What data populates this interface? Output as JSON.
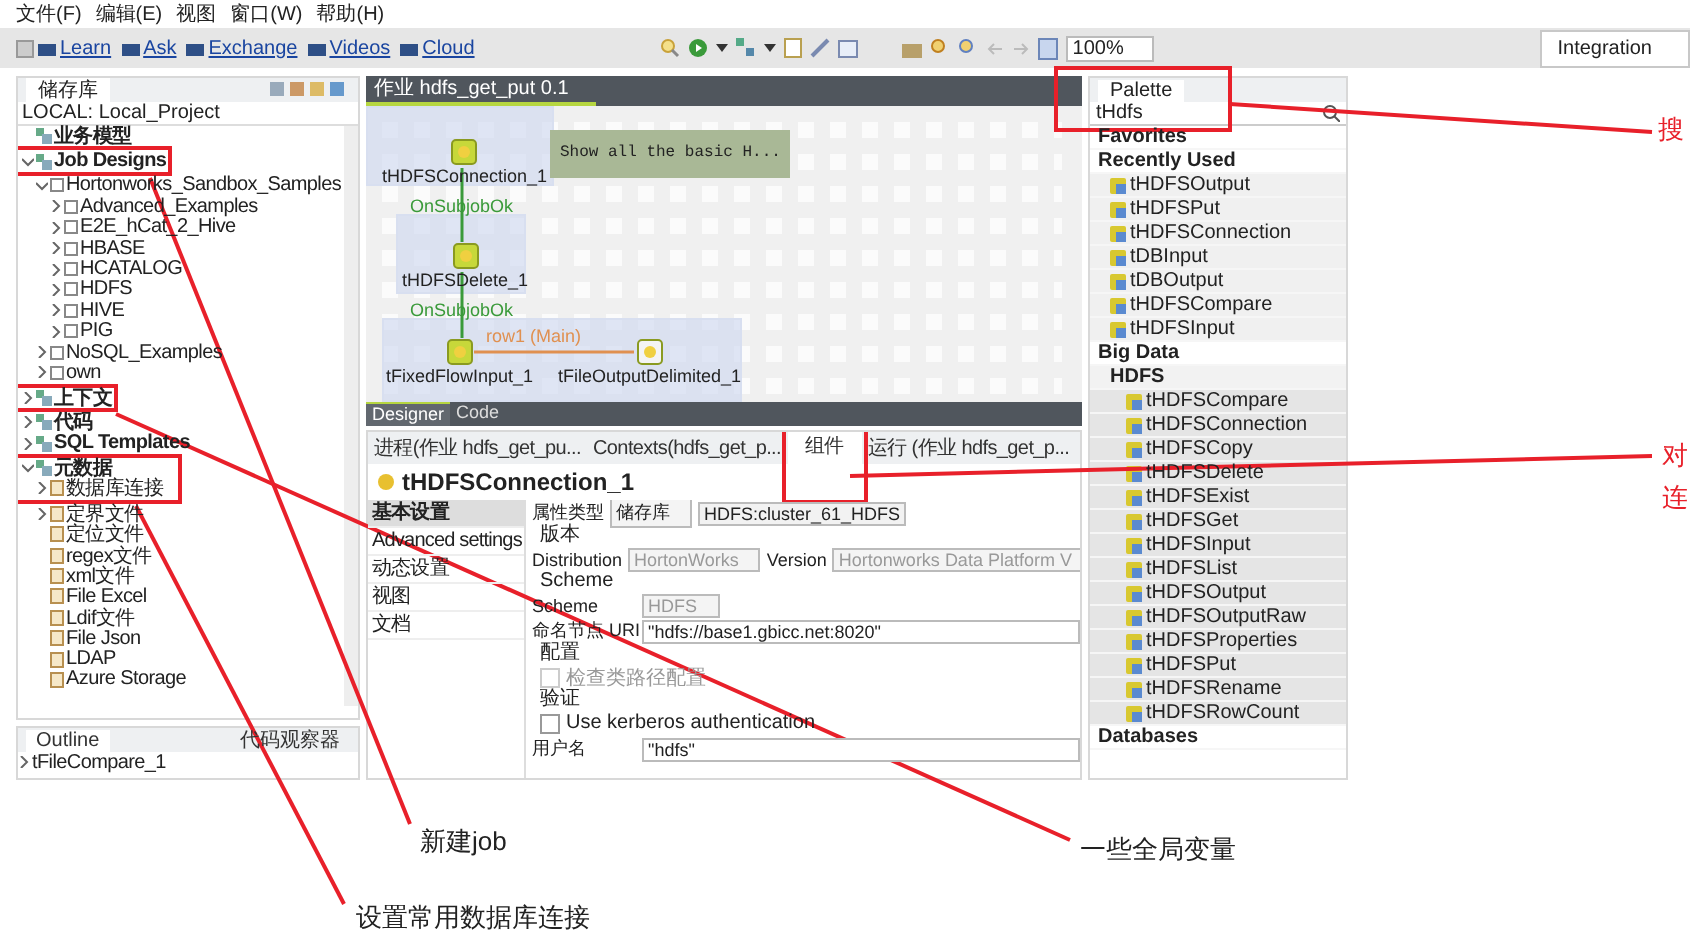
{
  "menu": [
    "文件(F)",
    "编辑(E)",
    "视图",
    "窗口(W)",
    "帮助(H)"
  ],
  "toolbar": {
    "links": [
      "Learn",
      "Ask",
      "Exchange",
      "Videos",
      "Cloud"
    ],
    "zoom": "100%",
    "perspective": "Integration"
  },
  "repository": {
    "title": "储存库",
    "project": "LOCAL: Local_Project",
    "tree": [
      {
        "kind": "category",
        "label": "业务模型"
      },
      {
        "kind": "category",
        "label": "Job Designs",
        "expanded": true,
        "children": [
          {
            "kind": "folder",
            "label": "Hortonworks_Sandbox_Samples",
            "expanded": true,
            "children": [
              {
                "kind": "folder",
                "label": "Advanced_Examples",
                "expanded": false
              },
              {
                "kind": "folder",
                "label": "E2E_hCat_2_Hive",
                "expanded": false
              },
              {
                "kind": "folder",
                "label": "HBASE",
                "expanded": false
              },
              {
                "kind": "folder",
                "label": "HCATALOG",
                "expanded": false
              },
              {
                "kind": "folder",
                "label": "HDFS",
                "expanded": false
              },
              {
                "kind": "folder",
                "label": "HIVE",
                "expanded": false
              },
              {
                "kind": "folder",
                "label": "PIG",
                "expanded": false
              }
            ]
          },
          {
            "kind": "folder",
            "label": "NoSQL_Examples",
            "expanded": false
          },
          {
            "kind": "folder",
            "label": "own",
            "expanded": false
          }
        ]
      },
      {
        "kind": "category",
        "label": "上下文",
        "expanded": false
      },
      {
        "kind": "category",
        "label": "代码",
        "expanded": false
      },
      {
        "kind": "category",
        "label": "SQL Templates",
        "expanded": false
      },
      {
        "kind": "category",
        "label": "元数据",
        "expanded": true,
        "children": [
          {
            "kind": "file",
            "label": "数据库连接",
            "expanded": false
          },
          {
            "kind": "file",
            "label": "定界文件",
            "expanded": false
          },
          {
            "kind": "file",
            "label": "定位文件"
          },
          {
            "kind": "file",
            "label": "regex文件"
          },
          {
            "kind": "file",
            "label": "xml文件"
          },
          {
            "kind": "file",
            "label": "File Excel"
          },
          {
            "kind": "file",
            "label": "Ldif文件"
          },
          {
            "kind": "file",
            "label": "File Json"
          },
          {
            "kind": "file",
            "label": "LDAP"
          },
          {
            "kind": "file",
            "label": "Azure Storage"
          }
        ]
      }
    ]
  },
  "outline": {
    "tabs": [
      {
        "label": "Outline",
        "selected": true
      },
      {
        "label": "代码观察器",
        "selected": false
      }
    ],
    "tree": [
      {
        "label": "tFileCompare_1",
        "expanded": false
      }
    ]
  },
  "editor": {
    "tab": "作业 hdfs_get_put 0.1",
    "nodes": [
      {
        "label": "tHDFSConnection_1"
      },
      {
        "label": "tHDFSDelete_1"
      },
      {
        "label": "tFixedFlowInput_1"
      },
      {
        "label": "tFileOutputDelimited_1"
      }
    ],
    "note": "Show all the basic H...",
    "triggers": [
      "OnSubjobOk",
      "OnSubjobOk"
    ],
    "link": "row1 (Main)",
    "view_tabs": [
      {
        "label": "Designer",
        "selected": true
      },
      {
        "label": "Code",
        "selected": false
      }
    ]
  },
  "bottom": {
    "tabs": [
      {
        "label": "进程(作业 hdfs_get_pu...",
        "selected": false
      },
      {
        "label": "Contexts(hdfs_get_p...",
        "selected": false
      },
      {
        "label": "组件",
        "selected": true
      },
      {
        "label": "运行 (作业 hdfs_get_p...",
        "selected": false
      }
    ],
    "component": "tHDFSConnection_1",
    "side_tabs": [
      {
        "label": "基本设置",
        "selected": true
      },
      {
        "label": "Advanced settings",
        "selected": false
      },
      {
        "label": "动态设置",
        "selected": false
      },
      {
        "label": "视图",
        "selected": false
      },
      {
        "label": "文档",
        "selected": false
      }
    ],
    "form": [
      {
        "kind": "select-text",
        "label": "属性类型",
        "select": "储存库",
        "value": "HDFS:cluster_61_HDFS"
      },
      {
        "kind": "group",
        "label": "版本"
      },
      {
        "kind": "select-pair",
        "label": "Distribution",
        "value": "HortonWorks",
        "label_2": "Version",
        "value_2": "Hortonworks Data Platform V",
        "disabled": true
      },
      {
        "kind": "group",
        "label": "Scheme"
      },
      {
        "kind": "select",
        "label": "Scheme",
        "value": "HDFS",
        "disabled": true
      },
      {
        "kind": "text",
        "label": "命名节点 URI",
        "value": "\"hdfs://base1.gbicc.net:8020\""
      },
      {
        "kind": "group",
        "label": "配置"
      },
      {
        "kind": "checkbox",
        "label": "检查类路径配置",
        "checked": false,
        "disabled": true
      },
      {
        "kind": "group",
        "label": "验证"
      },
      {
        "kind": "checkbox",
        "label": "Use kerberos authentication",
        "checked": false,
        "disabled": false
      },
      {
        "kind": "text",
        "label": "用户名",
        "value": "\"hdfs\""
      }
    ]
  },
  "palette": {
    "title": "Palette",
    "search": "tHdfs",
    "items": [
      {
        "kind": "section",
        "label": "Favorites"
      },
      {
        "kind": "section",
        "label": "Recently Used"
      },
      {
        "kind": "component",
        "label": "tHDFSOutput"
      },
      {
        "kind": "component",
        "label": "tHDFSPut"
      },
      {
        "kind": "component",
        "label": "tHDFSConnection"
      },
      {
        "kind": "component",
        "label": "tDBInput"
      },
      {
        "kind": "component",
        "label": "tDBOutput"
      },
      {
        "kind": "component",
        "label": "tHDFSCompare"
      },
      {
        "kind": "component",
        "label": "tHDFSInput"
      },
      {
        "kind": "section",
        "label": "Big Data"
      },
      {
        "kind": "folder",
        "label": "HDFS"
      },
      {
        "kind": "nested-component",
        "label": "tHDFSCompare"
      },
      {
        "kind": "nested-component",
        "label": "tHDFSConnection"
      },
      {
        "kind": "nested-component",
        "label": "tHDFSCopy"
      },
      {
        "kind": "nested-component",
        "label": "tHDFSDelete"
      },
      {
        "kind": "nested-component",
        "label": "tHDFSExist"
      },
      {
        "kind": "nested-component",
        "label": "tHDFSGet"
      },
      {
        "kind": "nested-component",
        "label": "tHDFSInput"
      },
      {
        "kind": "nested-component",
        "label": "tHDFSList"
      },
      {
        "kind": "nested-component",
        "label": "tHDFSOutput"
      },
      {
        "kind": "nested-component",
        "label": "tHDFSOutputRaw"
      },
      {
        "kind": "nested-component",
        "label": "tHDFSProperties"
      },
      {
        "kind": "nested-component",
        "label": "tHDFSPut"
      },
      {
        "kind": "nested-component",
        "label": "tHDFSRename"
      },
      {
        "kind": "nested-component",
        "label": "tHDFSRowCount"
      },
      {
        "kind": "section",
        "label": "Databases"
      }
    ]
  },
  "annotations": [
    {
      "text": "新建job"
    },
    {
      "text": "一些全局变量"
    },
    {
      "text": "设置常用数据库连接"
    },
    {
      "text": "搜"
    },
    {
      "text": "对"
    },
    {
      "text": "连"
    }
  ]
}
